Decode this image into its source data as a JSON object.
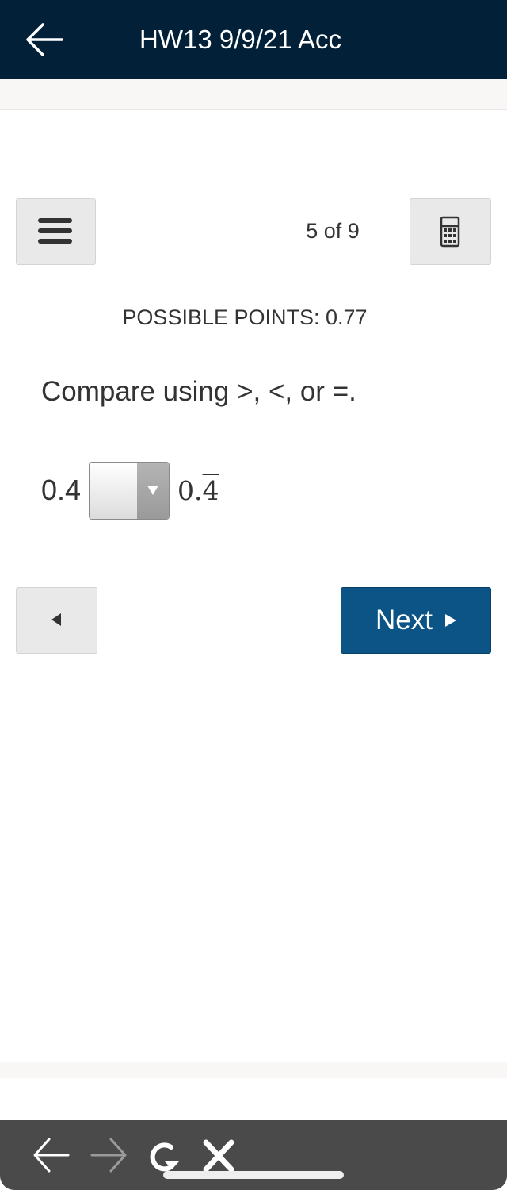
{
  "header": {
    "title": "HW13 9/9/21 Acc",
    "back_icon": "arrow-left-icon",
    "background": "#022139"
  },
  "toolbar": {
    "menu_icon": "hamburger-menu-icon",
    "progress": "5 of 9",
    "calculator_icon": "calculator-icon"
  },
  "question": {
    "possible_points": "POSSIBLE POINTS: 0.77",
    "prompt": "Compare using >, <, or =.",
    "left_value": "0.4",
    "comparison_dropdown": {
      "selected": "",
      "icon": "dropdown-triangle-icon"
    },
    "right_value_whole": "0.",
    "right_value_repeating": "4"
  },
  "navigation": {
    "prev_icon": "triangle-left-icon",
    "next_label": "Next",
    "next_icon": "triangle-right-icon",
    "next_color": "#0b5485"
  },
  "browser_bar": {
    "back_icon": "arrow-left-icon",
    "forward_icon": "arrow-right-icon",
    "reload_icon": "reload-icon",
    "close_icon": "close-icon"
  }
}
